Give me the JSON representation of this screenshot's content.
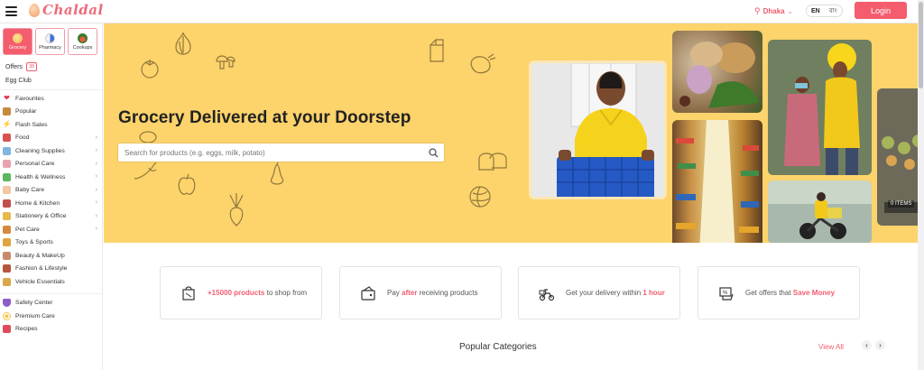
{
  "header": {
    "logo_text": "Chaldal",
    "location": "Dhaka",
    "lang_en": "EN",
    "lang_bn": "বাং",
    "login_label": "Login"
  },
  "sidebar": {
    "tabs": [
      {
        "label": "Grocery",
        "active": true
      },
      {
        "label": "Pharmacy",
        "active": false
      },
      {
        "label": "Cookups",
        "active": false
      }
    ],
    "offers_label": "Offers",
    "offers_count": "38",
    "egg_club_label": "Egg Club",
    "items": [
      {
        "label": "Favourites",
        "icon": "heart-icon",
        "chevron": false
      },
      {
        "label": "Popular",
        "icon": "popular-icon",
        "chevron": false
      },
      {
        "label": "Flash Sales",
        "icon": "flash-icon",
        "chevron": false
      },
      {
        "label": "Food",
        "icon": "food-icon",
        "chevron": true
      },
      {
        "label": "Cleaning Supplies",
        "icon": "cleaning-icon",
        "chevron": true
      },
      {
        "label": "Personal Care",
        "icon": "personal-care-icon",
        "chevron": true
      },
      {
        "label": "Health & Wellness",
        "icon": "health-icon",
        "chevron": true
      },
      {
        "label": "Baby Care",
        "icon": "baby-care-icon",
        "chevron": true
      },
      {
        "label": "Home & Kitchen",
        "icon": "home-kitchen-icon",
        "chevron": true
      },
      {
        "label": "Stationery & Office",
        "icon": "stationery-icon",
        "chevron": true
      },
      {
        "label": "Pet Care",
        "icon": "pet-care-icon",
        "chevron": true
      },
      {
        "label": "Toys & Sports",
        "icon": "toys-icon",
        "chevron": false
      },
      {
        "label": "Beauty & MakeUp",
        "icon": "beauty-icon",
        "chevron": false
      },
      {
        "label": "Fashion & Lifestyle",
        "icon": "fashion-icon",
        "chevron": false
      },
      {
        "label": "Vehicle Essentials",
        "icon": "vehicle-icon",
        "chevron": false
      }
    ],
    "bottom_items": [
      {
        "label": "Safety Center",
        "icon": "shield-icon"
      },
      {
        "label": "Premium Care",
        "icon": "premium-icon"
      },
      {
        "label": "Recipes",
        "icon": "recipe-icon"
      }
    ]
  },
  "hero": {
    "title": "Grocery Delivered at your Doorstep",
    "search_placeholder": "Search for products (e.g. eggs, milk, potato)",
    "items_badge": "0 ITEMS"
  },
  "features": [
    {
      "pre": "",
      "highlight": "+15000 products",
      "post": " to shop from",
      "icon": "bag-icon"
    },
    {
      "pre": "Pay ",
      "highlight": "after",
      "post": " receiving products",
      "icon": "wallet-icon"
    },
    {
      "pre": "Get your delivery within ",
      "highlight": "1 hour",
      "post": "",
      "icon": "scooter-icon"
    },
    {
      "pre": "Get offers that ",
      "highlight": "Save Money",
      "post": "",
      "icon": "offer-icon"
    }
  ],
  "popular": {
    "title": "Popular Categories",
    "view_all": "View All"
  },
  "colors": {
    "brand": "#f45d6e",
    "hero_bg": "#fdd36b"
  }
}
